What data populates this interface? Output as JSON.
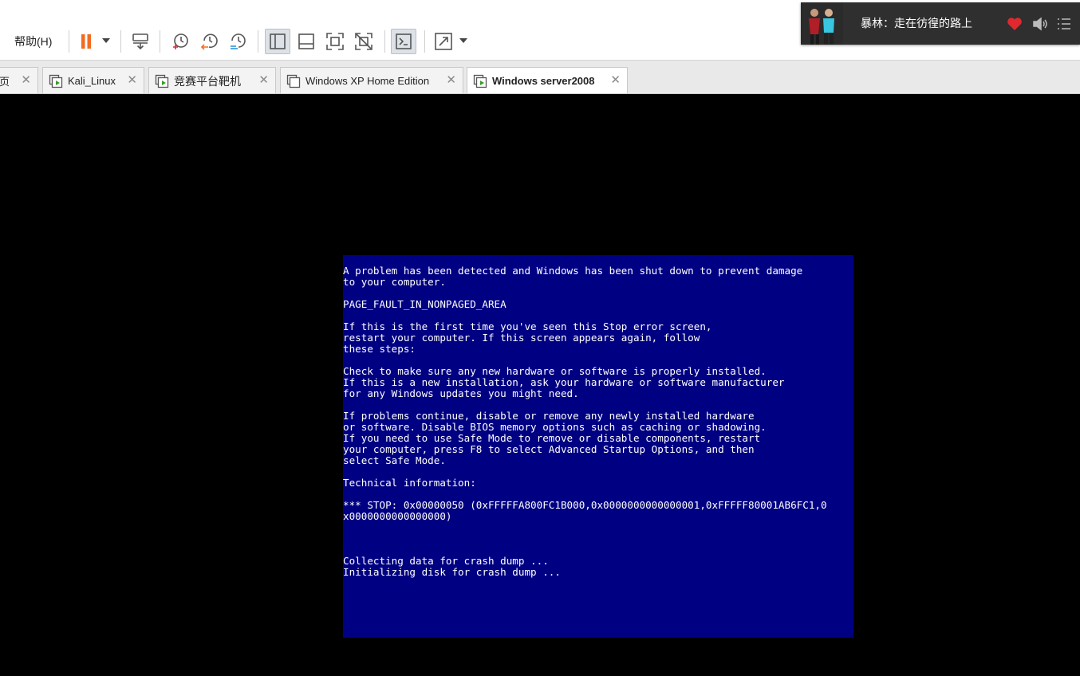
{
  "menu": {
    "help_label": "帮助(H)"
  },
  "toolbar": {
    "buttons": [
      {
        "icon": "pause-icon",
        "color": "#f26b21"
      },
      {
        "icon": "send-ctrl-alt-del-icon"
      },
      {
        "icon": "snapshot-take-icon"
      },
      {
        "icon": "snapshot-revert-icon"
      },
      {
        "icon": "snapshot-manager-icon"
      },
      {
        "icon": "show-library-icon",
        "pressed": true
      },
      {
        "icon": "show-thumbnail-bar-icon"
      },
      {
        "icon": "fit-guest-icon"
      },
      {
        "icon": "no-stretch-icon"
      },
      {
        "icon": "console-view-icon",
        "pressed": true
      },
      {
        "icon": "full-screen-icon"
      }
    ]
  },
  "tabs": [
    {
      "label": "页",
      "active": false
    },
    {
      "label": "Kali_Linux",
      "active": false
    },
    {
      "label": "竞赛平台靶机",
      "active": false
    },
    {
      "label": "Windows XP Home Edition",
      "active": false
    },
    {
      "label": "Windows server2008",
      "active": true
    }
  ],
  "tab_close_glyph": "✕",
  "guest_screen": {
    "background": "#000082",
    "lines": [
      "A problem has been detected and Windows has been shut down to prevent damage",
      "to your computer.",
      "",
      "PAGE_FAULT_IN_NONPAGED_AREA",
      "",
      "If this is the first time you've seen this Stop error screen,",
      "restart your computer. If this screen appears again, follow",
      "these steps:",
      "",
      "Check to make sure any new hardware or software is properly installed.",
      "If this is a new installation, ask your hardware or software manufacturer",
      "for any Windows updates you might need.",
      "",
      "If problems continue, disable or remove any newly installed hardware",
      "or software. Disable BIOS memory options such as caching or shadowing.",
      "If you need to use Safe Mode to remove or disable components, restart",
      "your computer, press F8 to select Advanced Startup Options, and then",
      "select Safe Mode.",
      "",
      "Technical information:",
      "",
      "*** STOP: 0x00000050 (0xFFFFFA800FC1B000,0x0000000000000001,0xFFFFF80001AB6FC1,0",
      "x0000000000000000)",
      "",
      "",
      "",
      "Collecting data for crash dump ...",
      "Initializing disk for crash dump ..."
    ]
  },
  "music_player": {
    "song": "暴林：走在彷徨的路上",
    "like_color": "#e0282e"
  }
}
